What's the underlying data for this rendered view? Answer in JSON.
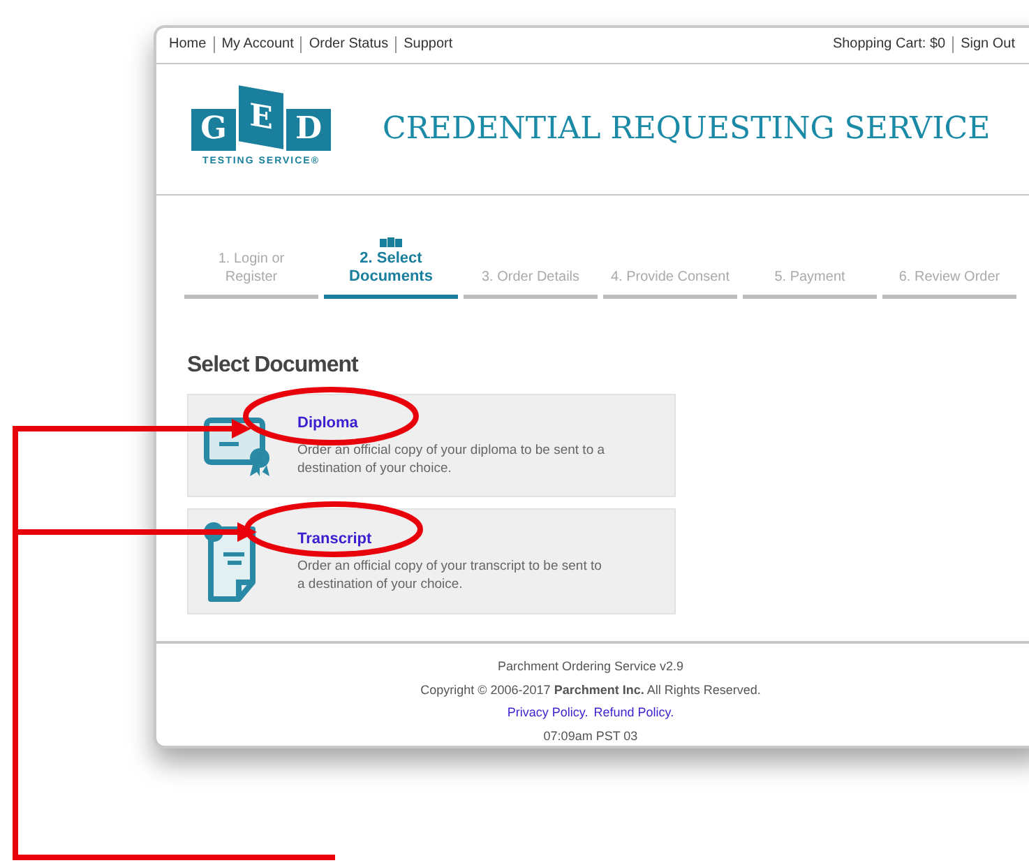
{
  "top_nav": {
    "left_links": [
      "Home",
      "My Account",
      "Order Status",
      "Support"
    ],
    "right_links": [
      "Shopping Cart: $0",
      "Sign Out"
    ]
  },
  "header": {
    "logo_letters": [
      "G",
      "E",
      "D"
    ],
    "logo_subtitle": "TESTING SERVICE®",
    "title": "CREDENTIAL REQUESTING SERVICE"
  },
  "steps": [
    {
      "label": "1. Login or Register",
      "selected": false
    },
    {
      "label": "2. Select Documents",
      "selected": true
    },
    {
      "label": "3. Order Details",
      "selected": false
    },
    {
      "label": "4. Provide Consent",
      "selected": false
    },
    {
      "label": "5. Payment",
      "selected": false
    },
    {
      "label": "6. Review Order",
      "selected": false
    }
  ],
  "section_title": "Select Document",
  "documents": [
    {
      "kind": "diploma",
      "title": "Diploma",
      "description": "Order an official copy of your diploma to be sent to a destination of your choice."
    },
    {
      "kind": "transcript",
      "title": "Transcript",
      "description": "Order an official copy of your transcript to be sent to a destination of your choice."
    }
  ],
  "footer": {
    "version": "Parchment Ordering Service v2.9",
    "copyright": "Copyright © 2006-2017 **Parchment Inc.** All Rights Reserved.",
    "links": [
      "Privacy Policy.",
      "Refund Policy."
    ],
    "time": "07:09am PST 03"
  }
}
